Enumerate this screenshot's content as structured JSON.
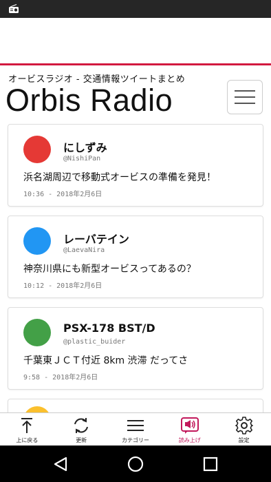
{
  "status_bar": {
    "icon": "radio-icon"
  },
  "header": {
    "subtitle": "オービスラジオ - 交通情報ツイートまとめ",
    "title": "Orbis Radio",
    "accent_color": "#d2193f",
    "menu_icon": "hamburger-menu-icon"
  },
  "tweets": [
    {
      "name": "にしずみ",
      "handle": "@NishiPan",
      "message": "浜名湖周辺で移動式オービスの準備を発見！",
      "time": "10:36 - 2018年2月6日",
      "avatar_color": "#e53935"
    },
    {
      "name": "レーバテイン",
      "handle": "@LaevaNira",
      "message": "神奈川県にも新型オービスってあるの？",
      "time": "10:12 - 2018年2月6日",
      "avatar_color": "#2196f3"
    },
    {
      "name": "PSX-178 BST/D",
      "handle": "@plastic_buider",
      "message": "千葉東ＪＣＴ付近 8km 渋滞 だってさ",
      "time": "9:58 - 2018年2月6日",
      "avatar_color": "#43a047"
    },
    {
      "avatar_color": "#fbc02d"
    }
  ],
  "tabs": [
    {
      "label": "上に戻る",
      "icon": "arrow-up-to-top-icon"
    },
    {
      "label": "更新",
      "icon": "refresh-icon"
    },
    {
      "label": "カテゴリー",
      "icon": "list-icon"
    },
    {
      "label": "読み上げ",
      "icon": "speak-icon",
      "active": true,
      "active_color": "#c2185b"
    },
    {
      "label": "設定",
      "icon": "gear-icon"
    }
  ],
  "nav_bar": {
    "back": "back-triangle-icon",
    "home": "home-circle-icon",
    "recents": "recents-square-icon"
  }
}
